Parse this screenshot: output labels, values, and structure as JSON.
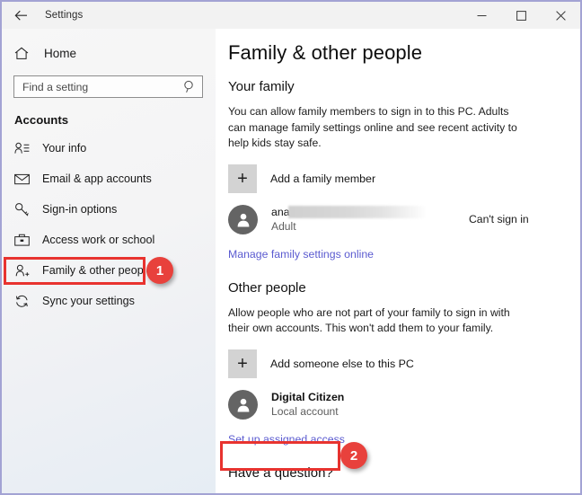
{
  "window": {
    "title": "Settings",
    "back_icon": "back-arrow-icon",
    "controls": {
      "minimize": "minimize-icon",
      "maximize": "maximize-icon",
      "close": "close-icon"
    },
    "border_color": "#a3a3d4"
  },
  "sidebar": {
    "home_label": "Home",
    "home_icon": "home-icon",
    "search": {
      "placeholder": "Find a setting",
      "value": "",
      "icon": "search-icon"
    },
    "section_title": "Accounts",
    "items": [
      {
        "label": "Your info",
        "icon": "user-info-icon",
        "selected": false
      },
      {
        "label": "Email & app accounts",
        "icon": "envelope-icon",
        "selected": false
      },
      {
        "label": "Sign-in options",
        "icon": "key-icon",
        "selected": false
      },
      {
        "label": "Access work or school",
        "icon": "briefcase-icon",
        "selected": false
      },
      {
        "label": "Family & other people",
        "icon": "add-person-icon",
        "selected": true
      },
      {
        "label": "Sync your settings",
        "icon": "sync-icon",
        "selected": false
      }
    ],
    "selection_bar_color": "#4f4fc4"
  },
  "main": {
    "page_title": "Family & other people",
    "your_family": {
      "heading": "Your family",
      "description": "You can allow family members to sign in to this PC. Adults can manage family settings online and see recent activity to help kids stay safe.",
      "add_member_label": "Add a family member",
      "add_member_icon": "plus-icon",
      "member": {
        "avatar_icon": "person-avatar-icon",
        "name": "ana",
        "name_redacted": true,
        "role": "Adult",
        "status": "Can't sign in"
      },
      "manage_link": "Manage family settings online"
    },
    "other_people": {
      "heading": "Other people",
      "description": "Allow people who are not part of your family to sign in with their own accounts. This won't add them to your family.",
      "add_someone_label": "Add someone else to this PC",
      "add_someone_icon": "plus-icon",
      "account": {
        "avatar_icon": "person-avatar-icon",
        "name": "Digital Citizen",
        "type": "Local account"
      },
      "assigned_access_link": "Set up assigned access"
    },
    "footer_heading": "Have a question?"
  },
  "annotations": {
    "color": "#e8413c",
    "badges": [
      {
        "number": "1",
        "target": "sidebar-item-family-other-people"
      },
      {
        "number": "2",
        "target": "set-up-assigned-access-link"
      }
    ]
  }
}
